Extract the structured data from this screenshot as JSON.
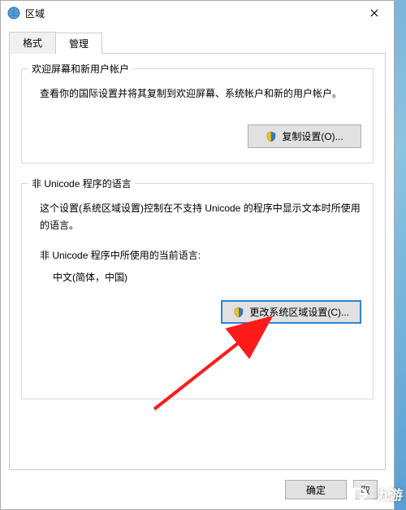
{
  "window": {
    "title": "区域"
  },
  "tabs": {
    "format": {
      "label": "格式"
    },
    "admin": {
      "label": "管理"
    }
  },
  "group1": {
    "legend": "欢迎屏幕和新用户帐户",
    "desc": "查看你的国际设置并将其复制到欢迎屏幕、系统帐户和新的用户帐户。",
    "button": "复制设置(O)..."
  },
  "group2": {
    "legend": "非 Unicode 程序的语言",
    "desc": "这个设置(系统区域设置)控制在不支持 Unicode 的程序中显示文本时所使用的语言。",
    "current_label": "非 Unicode 程序中所使用的当前语言:",
    "current_value": "中文(简体，中国)",
    "button": "更改系统区域设置(C)..."
  },
  "buttons": {
    "ok": "确定",
    "cancel": "取"
  },
  "watermark": {
    "text": "九游"
  }
}
